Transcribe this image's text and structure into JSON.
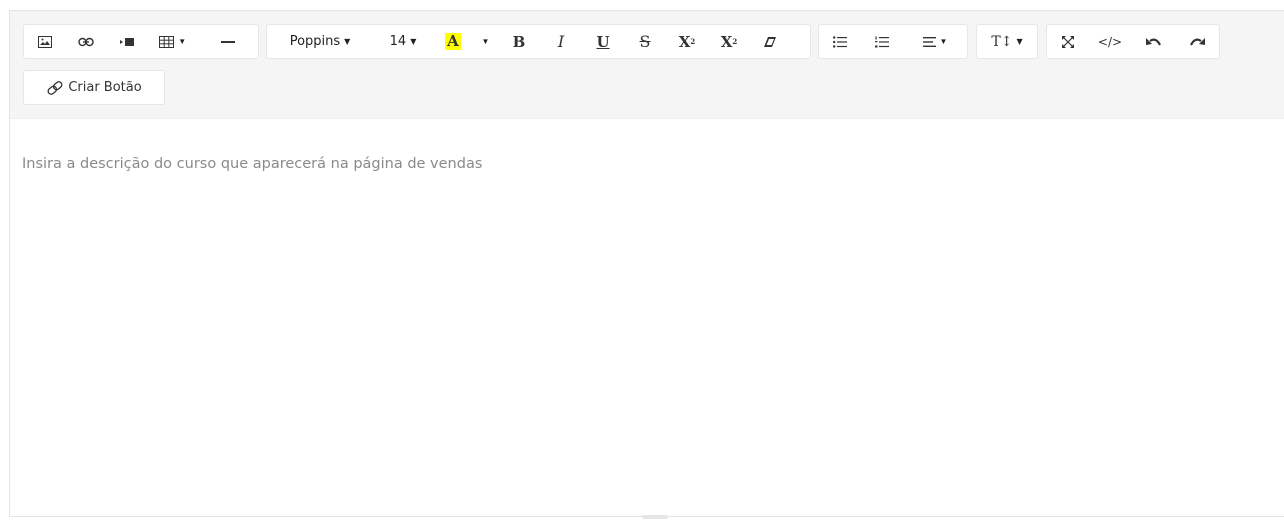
{
  "toolbar": {
    "font_name": "Poppins",
    "font_size": "14",
    "color_letter": "A",
    "color_highlight": "#ffff00",
    "bold_label": "B",
    "italic_label": "I",
    "underline_label": "U",
    "strike_label": "S",
    "superscript_label": "X",
    "subscript_label": "X",
    "font_size_menu_label": "T↕",
    "code_label": "</>",
    "create_button_label": "Criar Botão"
  },
  "editor": {
    "placeholder": "Insira a descrição do curso que aparecerá na página de vendas"
  }
}
